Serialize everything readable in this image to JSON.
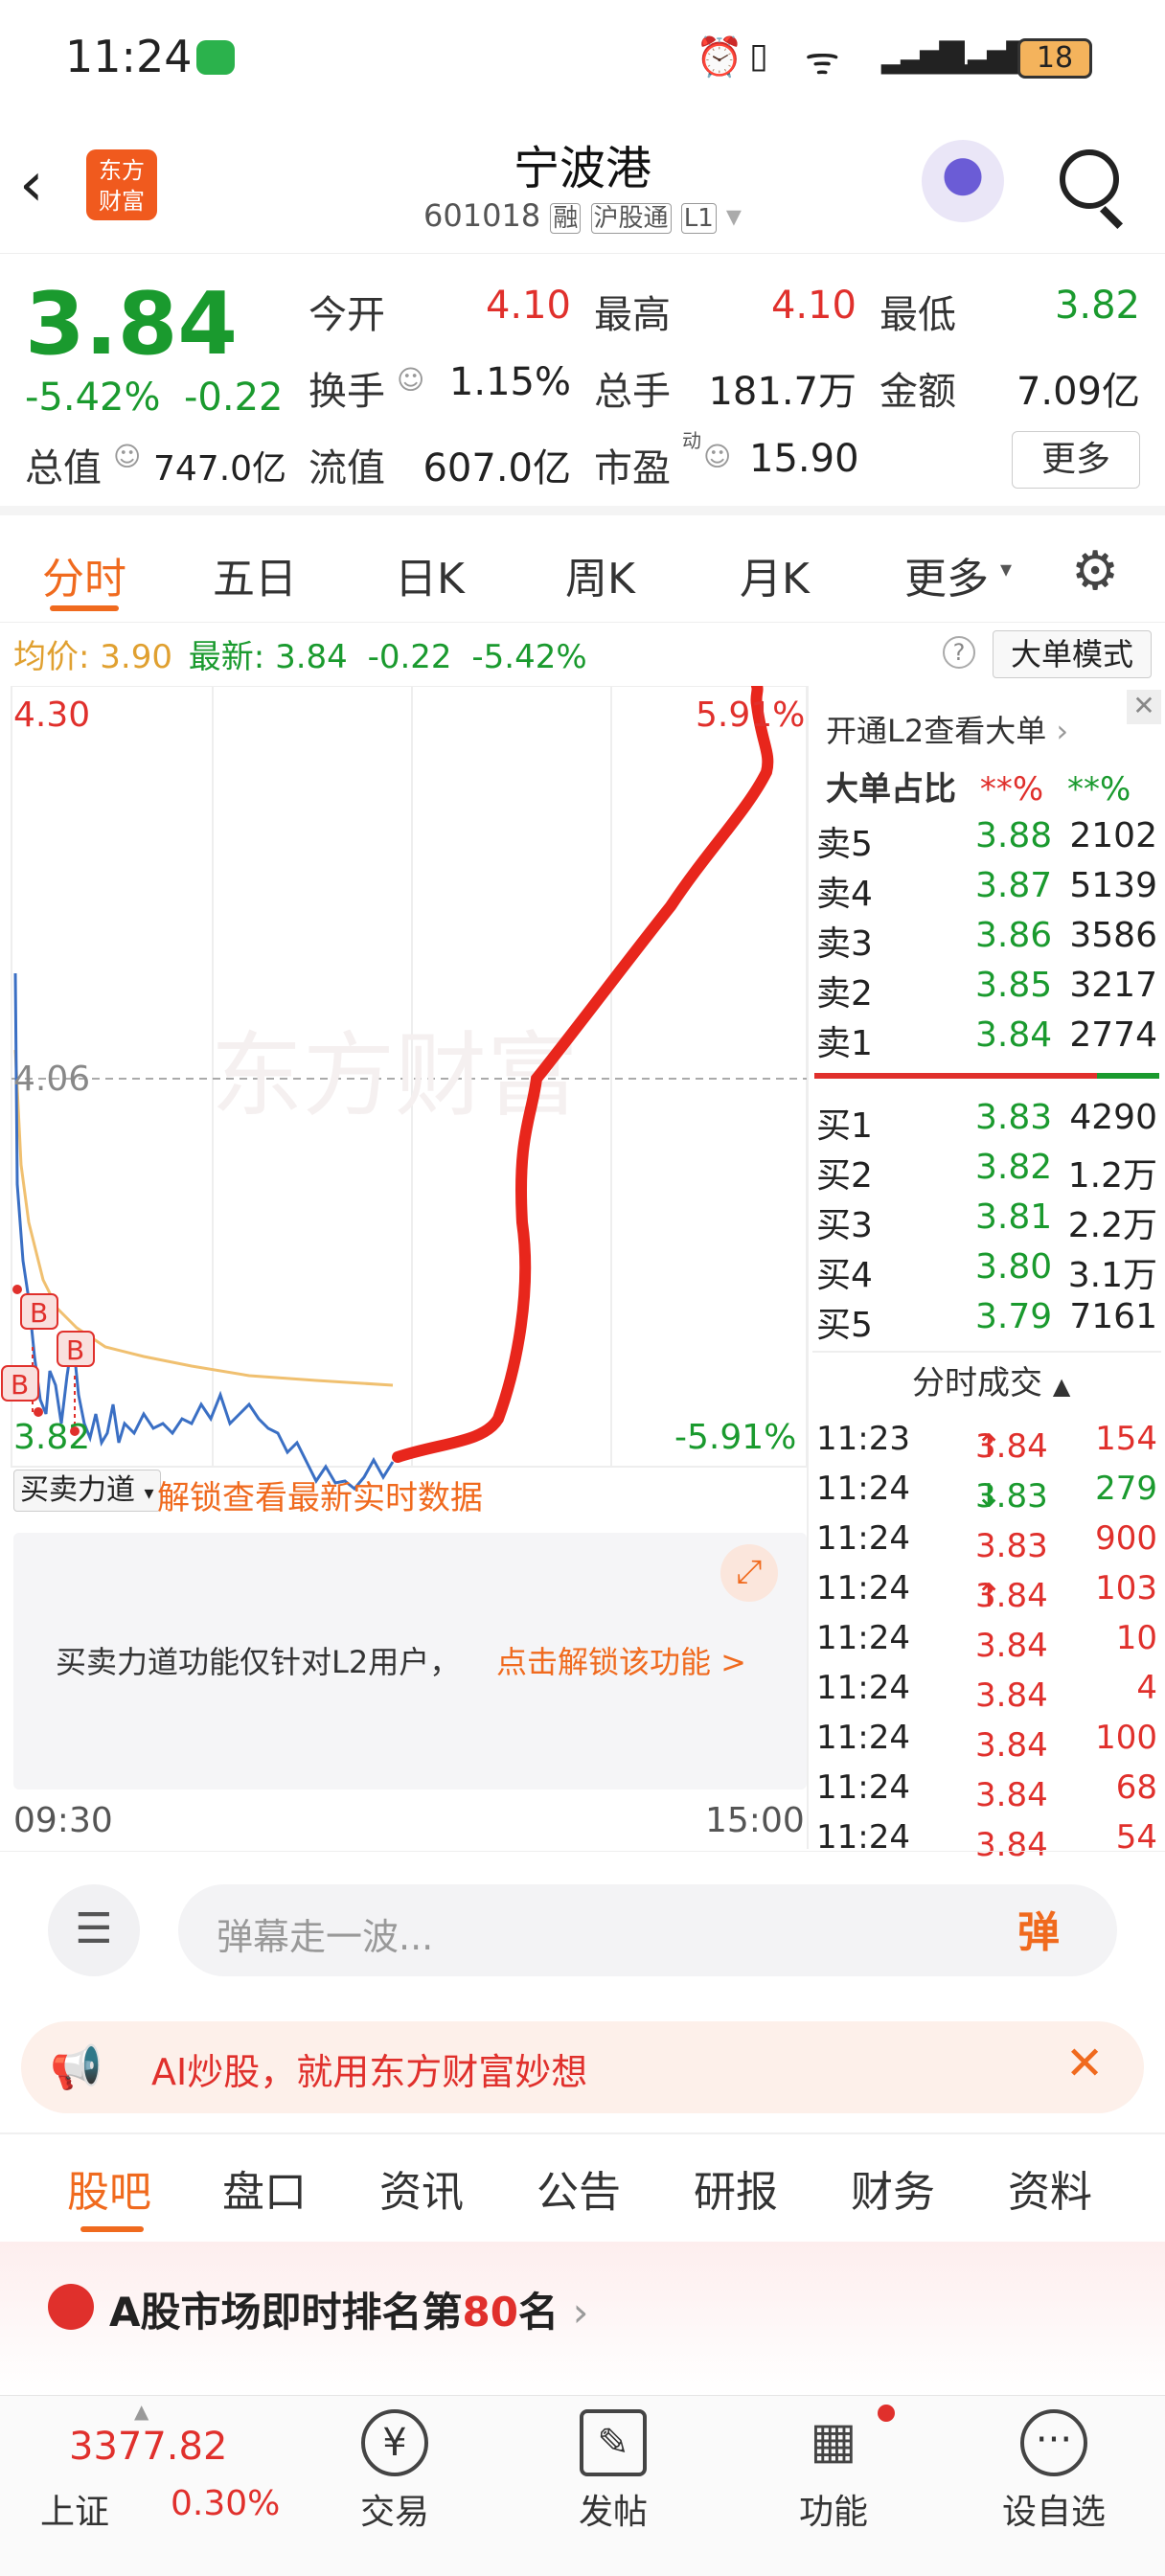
{
  "status_bar": {
    "time": "11:24",
    "battery": "18"
  },
  "header": {
    "title": "宁波港",
    "code": "601018",
    "badge_rong": "融",
    "badge_hgt": "沪股通",
    "badge_level": "L1",
    "logo_line1": "东方",
    "logo_line2": "财富"
  },
  "quote": {
    "price": "3.84",
    "change_pct": "-5.42%",
    "change": "-0.22",
    "open_label": "今开",
    "open": "4.10",
    "high_label": "最高",
    "high": "4.10",
    "low_label": "最低",
    "low": "3.82",
    "turnover_label": "换手",
    "turnover": "1.15%",
    "volume_label": "总手",
    "volume": "181.7万",
    "amount_label": "金额",
    "amount": "7.09亿",
    "mktcap_label": "总值",
    "mktcap": "747.0亿",
    "float_label": "流值",
    "float": "607.0亿",
    "pe_label": "市盈",
    "pe_super": "动",
    "pe": "15.90",
    "more": "更多"
  },
  "tabs": [
    "分时",
    "五日",
    "日K",
    "周K",
    "月K",
    "更多"
  ],
  "chart": {
    "avg_label": "均价:",
    "avg": "3.90",
    "latest_label": "最新:",
    "latest": "3.84",
    "latest_change": "-0.22",
    "latest_pct": "-5.42%",
    "mode_button": "大单模式",
    "y_top": "4.30",
    "y_mid": "4.06",
    "y_bottom": "3.82",
    "pct_top": "5.91%",
    "pct_bottom": "-5.91%",
    "watermark": "东方财富",
    "time_start": "09:30",
    "time_end": "15:00",
    "buy_marker": "B"
  },
  "orderbook": {
    "l2_link": "开通L2查看大单",
    "big_label": "大单占比",
    "big_buy": "**%",
    "big_sell": "**%",
    "asks": [
      {
        "label": "卖5",
        "price": "3.88",
        "vol": "2102"
      },
      {
        "label": "卖4",
        "price": "3.87",
        "vol": "5139"
      },
      {
        "label": "卖3",
        "price": "3.86",
        "vol": "3586"
      },
      {
        "label": "卖2",
        "price": "3.85",
        "vol": "3217"
      },
      {
        "label": "卖1",
        "price": "3.84",
        "vol": "2774"
      }
    ],
    "bids": [
      {
        "label": "买1",
        "price": "3.83",
        "vol": "4290"
      },
      {
        "label": "买2",
        "price": "3.82",
        "vol": "1.2万"
      },
      {
        "label": "买3",
        "price": "3.81",
        "vol": "2.2万"
      },
      {
        "label": "买4",
        "price": "3.80",
        "vol": "3.1万"
      },
      {
        "label": "买5",
        "price": "3.79",
        "vol": "7161"
      }
    ],
    "trades_title": "分时成交",
    "trades": [
      {
        "time": "11:23",
        "price": "3.84",
        "arrow": "↑",
        "vol": "154",
        "color": "red"
      },
      {
        "time": "11:24",
        "price": "3.83",
        "arrow": "↓",
        "vol": "279",
        "color": "green"
      },
      {
        "time": "11:24",
        "price": "3.83",
        "arrow": "",
        "vol": "900",
        "color": "red"
      },
      {
        "time": "11:24",
        "price": "3.84",
        "arrow": "↑",
        "vol": "103",
        "color": "red"
      },
      {
        "time": "11:24",
        "price": "3.84",
        "arrow": "",
        "vol": "10",
        "color": "red"
      },
      {
        "time": "11:24",
        "price": "3.84",
        "arrow": "",
        "vol": "4",
        "color": "red"
      },
      {
        "time": "11:24",
        "price": "3.84",
        "arrow": "",
        "vol": "100",
        "color": "red"
      },
      {
        "time": "11:24",
        "price": "3.84",
        "arrow": "",
        "vol": "68",
        "color": "red"
      },
      {
        "time": "11:24",
        "price": "3.84",
        "arrow": "",
        "vol": "54",
        "color": "red"
      }
    ]
  },
  "force": {
    "dropdown": "买卖力道",
    "unlock_text": "解锁查看最新实时数据",
    "notice": "买卖力道功能仅针对L2用户，",
    "notice_link": "点击解锁该功能 >"
  },
  "danmu": {
    "placeholder": "弹幕走一波...",
    "button": "弹"
  },
  "ai_banner": {
    "text": "AI炒股，就用东方财富妙想"
  },
  "sub_tabs": [
    "股吧",
    "盘口",
    "资讯",
    "公告",
    "研报",
    "财务",
    "资料"
  ],
  "ranking": {
    "prefix": "A股市场即时排名第",
    "rank": "80",
    "suffix": "名"
  },
  "bottom_nav": {
    "index_value": "3377.82",
    "index_name": "上证",
    "index_pct": "0.30%",
    "items": [
      "交易",
      "发帖",
      "功能",
      "设自选"
    ]
  },
  "colors": {
    "red": "#e0302c",
    "green": "#1a9a2e",
    "orange": "#f06a1e",
    "chart_line": "#3a6fc4",
    "avg_line": "#f0c070"
  }
}
